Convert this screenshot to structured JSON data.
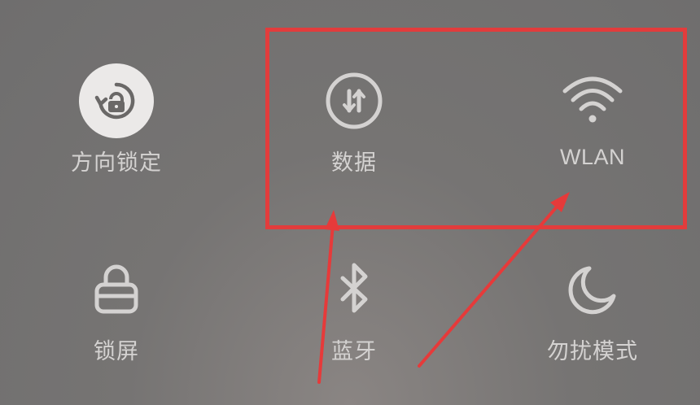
{
  "quick_settings": {
    "tiles": [
      {
        "label": "方向锁定",
        "icon": "rotation-lock-icon",
        "state": "on"
      },
      {
        "label": "数据",
        "icon": "mobile-data-icon",
        "state": "off"
      },
      {
        "label": "WLAN",
        "icon": "wifi-icon",
        "state": "off"
      },
      {
        "label": "锁屏",
        "icon": "padlock-icon",
        "state": "off"
      },
      {
        "label": "蓝牙",
        "icon": "bluetooth-icon",
        "state": "off"
      },
      {
        "label": "勿扰模式",
        "icon": "moon-icon",
        "state": "off"
      }
    ]
  },
  "annotation": {
    "highlight_color": "#e23c3c",
    "highlight_target": [
      "数据",
      "WLAN"
    ]
  },
  "colors": {
    "icon_stroke": "#d4d2d1",
    "active_tile_bg": "#ebe9e8",
    "active_icon": "#6a6867"
  }
}
